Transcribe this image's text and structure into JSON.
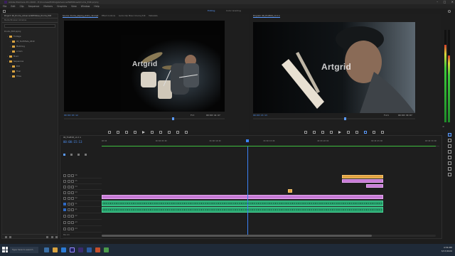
{
  "window": {
    "title": "Adobe Premiere Pro 2020 - E:\\Courses\\Editing\\AdvancedWithRose\\Drums_Edit.prproj",
    "controls": [
      "–",
      "□",
      "✕"
    ]
  },
  "menu": [
    "File",
    "Edit",
    "Clip",
    "Sequence",
    "Markers",
    "Graphics",
    "View",
    "Window",
    "Help"
  ],
  "workspaces": {
    "active": "Editing",
    "other": "Color Grading"
  },
  "project_panel": {
    "tab": "Project: 06_Drums_AdvancedWithRose_Drums_Edit",
    "sub_tabs": "Media Browser   Libraries",
    "root": "Drums_Edit.prproj",
    "items": [
      {
        "label": "Footage",
        "depth": 1
      },
      {
        "label": "05_ToothFade_2019",
        "depth": 2
      },
      {
        "label": "Matching",
        "depth": 2
      },
      {
        "label": "A Cam",
        "depth": 2
      },
      {
        "label": "Music",
        "depth": 1
      },
      {
        "label": "Sequences",
        "depth": 1
      },
      {
        "label": "Edit",
        "depth": 2
      },
      {
        "label": "Final",
        "depth": 2
      },
      {
        "label": "Titles",
        "depth": 2
      }
    ]
  },
  "source_monitor": {
    "tabs": [
      "Source: drums_playing_shot1_cut.mp4",
      "Effect Controls",
      "Audio Clip Mixer: Drums_Edit",
      "Metadata"
    ],
    "active_tab": 0,
    "watermark": "Artgrid",
    "timecode_in": "00:00:03:12",
    "fit": "Fit",
    "timecode_dur": "00:00:41:27"
  },
  "program_monitor": {
    "tabs": [
      "Program: 06_FirstEdit_v1.0 ≡"
    ],
    "active_tab": 0,
    "watermark": "Artgrid",
    "timecode_in": "00:00:15:13",
    "fit": "Full",
    "timecode_dur": "00:00:30:07"
  },
  "timeline": {
    "tab": "06_FirstEdit_v1.0 ≡",
    "timecode": "00:00:15:13",
    "ruler": [
      "00:00",
      "00:00:05:00",
      "00:00:10:00",
      "00:00:15:00",
      "00:00:20:00",
      "00:00:25:00",
      "00:00:30:00"
    ],
    "video_tracks": [
      "V6",
      "V5",
      "V4",
      "V3",
      "V2",
      "V1"
    ],
    "audio_tracks": [
      "A1",
      "A2",
      "A3",
      "A4"
    ],
    "mix_label": "Mix  0.0",
    "playhead_seconds": 15.54,
    "duration_seconds": 36
  },
  "meter": {
    "db_label": "dB",
    "level_left": 0.84,
    "level_right": 0.72
  },
  "taskbar": {
    "search_placeholder": "Type here to search",
    "time": "4:56 PM",
    "date": "3/17/2020"
  },
  "colors": {
    "accent": "#5b9bff",
    "video_clip": "#c77ad6",
    "orange_clip": "#e2a23f",
    "audio_clip": "#2aa872",
    "playhead": "#3b82f6"
  }
}
